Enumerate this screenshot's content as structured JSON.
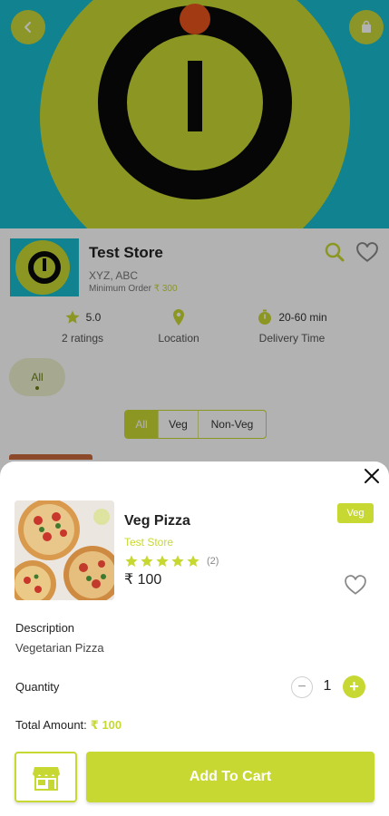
{
  "store": {
    "name": "Test Store",
    "address": "XYZ, ABC",
    "min_order_label": "Minimum Order",
    "min_order_value": "₹ 300",
    "stats": {
      "rating_value": "5.0",
      "rating_sub": "2 ratings",
      "location_label": "Location",
      "delivery_value": "20-60 min",
      "delivery_sub": "Delivery Time"
    },
    "category_chip": "All",
    "filters": [
      "All",
      "Veg",
      "Non-Veg"
    ]
  },
  "sheet": {
    "item_name": "Veg Pizza",
    "item_store": "Test Store",
    "rating": 5,
    "rating_count": "(2)",
    "price": "₹ 100",
    "badge": "Veg",
    "description_label": "Description",
    "description": "Vegetarian Pizza",
    "quantity_label": "Quantity",
    "quantity": "1",
    "total_label": "Total Amount:",
    "total_value": "₹ 100",
    "add_to_cart": "Add To Cart"
  },
  "colors": {
    "accent": "#c8d832",
    "hero_bg": "#19bacd",
    "logo_dot": "#e8541c"
  },
  "icons": [
    "back-arrow-icon",
    "cart-icon",
    "search-icon",
    "heart-icon",
    "star-icon",
    "location-pin-icon",
    "timer-icon",
    "close-icon",
    "minus-icon",
    "plus-icon",
    "storefront-icon"
  ]
}
